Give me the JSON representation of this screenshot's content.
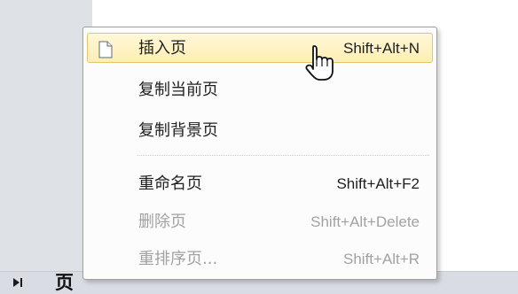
{
  "menu": {
    "items": [
      {
        "label": "插入页",
        "shortcut": "Shift+Alt+N",
        "highlighted": true,
        "enabled": true
      },
      {
        "label": "复制当前页",
        "shortcut": "",
        "highlighted": false,
        "enabled": true
      },
      {
        "label": "复制背景页",
        "shortcut": "",
        "highlighted": false,
        "enabled": true
      },
      {
        "label": "重命名页",
        "shortcut": "Shift+Alt+F2",
        "highlighted": false,
        "enabled": true
      },
      {
        "label": "删除页",
        "shortcut": "Shift+Alt+Delete",
        "highlighted": false,
        "enabled": false
      },
      {
        "label": "重排序页...",
        "shortcut": "Shift+Alt+R",
        "highlighted": false,
        "enabled": false
      }
    ]
  },
  "page_tabs": {
    "current_label": "页"
  },
  "icons": {
    "insert_page": "page-icon",
    "navigation": "next-page-arrow-icon",
    "pointer": "cursor-icon"
  },
  "colors": {
    "menu_highlight": "#ffefb9",
    "menu_highlight_border": "#e6c46d",
    "disabled_text": "#a2a2a2"
  }
}
